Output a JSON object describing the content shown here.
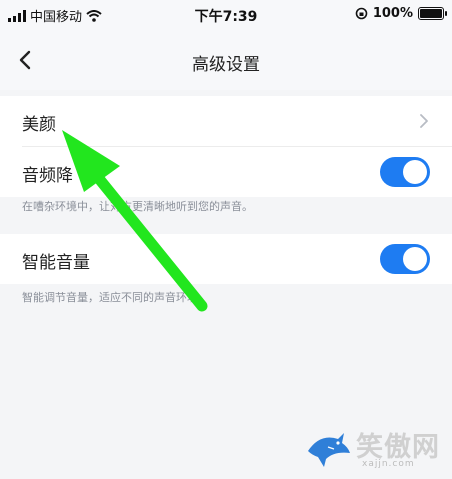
{
  "status_bar": {
    "carrier": "中国移动",
    "time": "下午7:39",
    "battery": "100%",
    "icons": [
      "signal-icon",
      "wifi-icon",
      "orientation-lock-icon",
      "battery-icon"
    ]
  },
  "nav": {
    "back_icon": "back-chevron-icon",
    "title": "高级设置"
  },
  "settings": [
    {
      "label": "美颜",
      "control": "chevron",
      "icon": "chevron-right-icon"
    },
    {
      "label": "音频降",
      "control": "toggle",
      "on": true,
      "hint": "在嘈杂环境中，让对方更清晰地听到您的声音。"
    },
    {
      "label": "智能音量",
      "control": "toggle",
      "on": true,
      "hint": "智能调节音量，适应不同的声音环境。"
    }
  ],
  "colors": {
    "accent": "#1e7cf2",
    "annotation_arrow": "#22e61e",
    "background": "#f4f5f7"
  },
  "watermark": {
    "text": "笑傲网",
    "url": "xajjn.com",
    "icon": "shark-logo-icon"
  }
}
